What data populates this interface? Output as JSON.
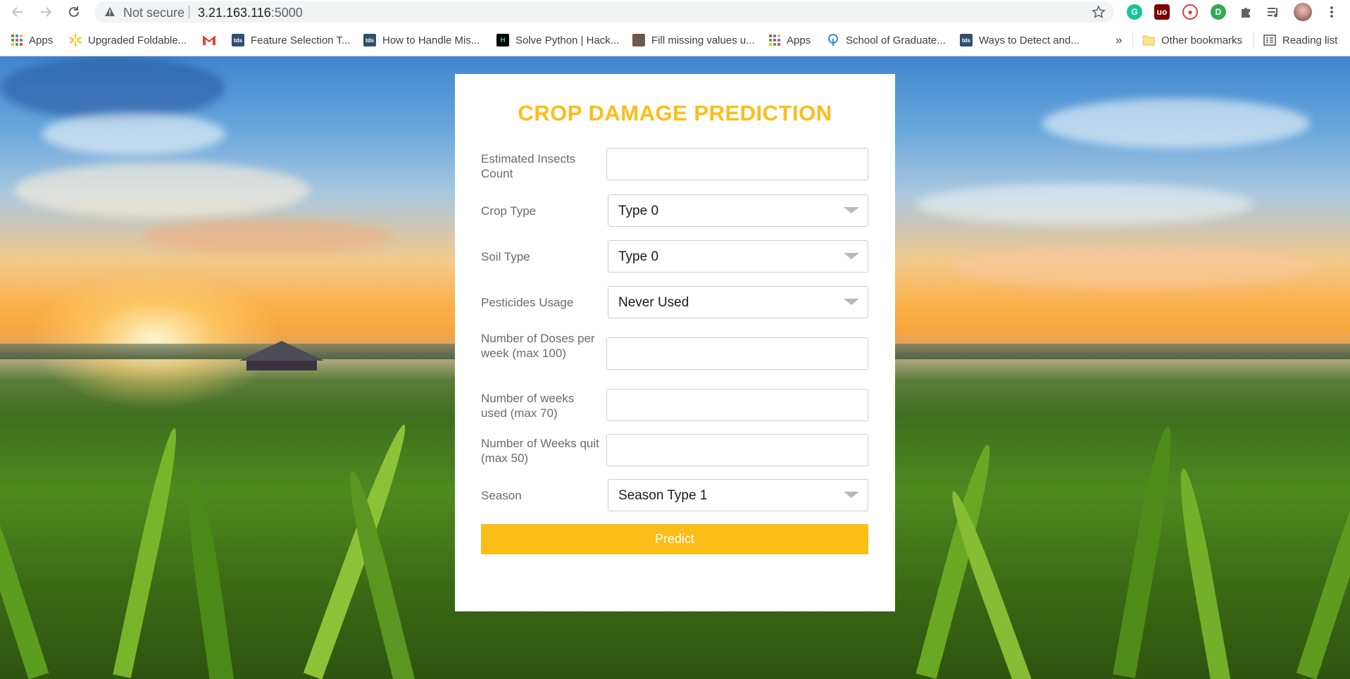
{
  "browser": {
    "security_label": "Not secure",
    "url_host": "3.21.163.116",
    "url_port": ":5000",
    "bookmarks": [
      {
        "label": "Apps"
      },
      {
        "label": "Upgraded Foldable..."
      },
      {
        "label": ""
      },
      {
        "label": "Feature Selection T..."
      },
      {
        "label": "How to Handle Mis..."
      },
      {
        "label": "Solve Python | Hack..."
      },
      {
        "label": "Fill missing values u..."
      },
      {
        "label": "Apps"
      },
      {
        "label": "School of Graduate..."
      },
      {
        "label": "Ways to Detect and..."
      }
    ],
    "overflow_label": "»",
    "other_bookmarks": "Other bookmarks",
    "reading_list": "Reading list"
  },
  "form": {
    "title": "CROP DAMAGE PREDICTION",
    "insects_label": "Estimated Insects Count",
    "insects_value": "",
    "crop_type_label": "Crop Type",
    "crop_type_value": "Type 0",
    "soil_type_label": "Soil Type",
    "soil_type_value": "Type 0",
    "pesticides_label": "Pesticides Usage",
    "pesticides_value": "Never Used",
    "doses_label": "Number of Doses per week (max 100)",
    "doses_value": "",
    "weeks_used_label": "Number of weeks used (max 70)",
    "weeks_used_value": "",
    "weeks_quit_label": "Number of Weeks quit (max 50)",
    "weeks_quit_value": "",
    "season_label": "Season",
    "season_value": "Season Type 1",
    "predict_label": "Predict"
  },
  "colors": {
    "accent": "#fbbd18",
    "label_text": "#6b6b6b"
  }
}
